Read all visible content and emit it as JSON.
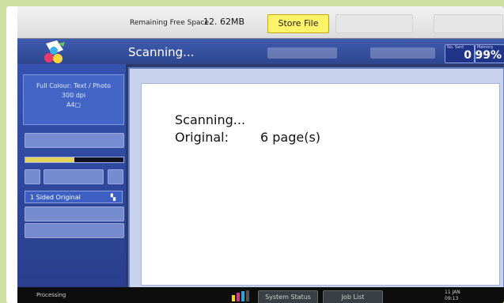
{
  "topbar": {
    "free_space_label": "Remaining Free Space",
    "free_space_value": "12. 62MB",
    "store_file_label": "Store File"
  },
  "header": {
    "title": "Scanning..."
  },
  "counters": [
    {
      "caption": "No. Sent",
      "value": "0"
    },
    {
      "caption": "Memory",
      "value": "99%"
    }
  ],
  "left_panel": {
    "mode_lines": [
      "Full Colour: Text / Photo",
      "300 dpi",
      "A4▢"
    ],
    "original_type": "1 Sided Original"
  },
  "dialog": {
    "title": "Scanning...",
    "original_label": "Original:",
    "original_value": "6 page(s)"
  },
  "bottombar": {
    "status": "Processing",
    "buttons": [
      "System Status",
      "Job List"
    ],
    "date": "11 JAN",
    "time": "09:13"
  },
  "colors": {
    "screen_bg": "#2b3a6c",
    "header": "#3f5bb0",
    "store_file": "#fff36a",
    "page_bg": "#cfe0a3"
  },
  "icons": {
    "logo": "scanner-logo-icon",
    "toner": "toner-level-icon",
    "original_type": "document-icon"
  }
}
